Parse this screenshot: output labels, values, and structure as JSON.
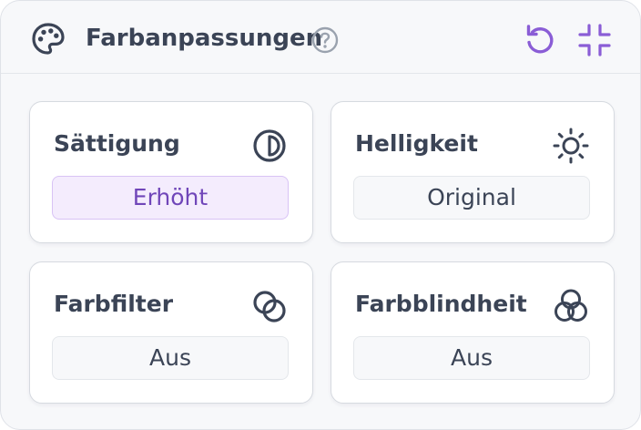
{
  "panel": {
    "title": "Farbanpassungen",
    "icons": {
      "header": "palette-icon",
      "help": "question-circle-icon",
      "reset": "reset-icon",
      "collapse": "collapse-icon"
    }
  },
  "cards": [
    {
      "label": "Sättigung",
      "value": "Erhöht",
      "icon": "contrast-icon",
      "active": true
    },
    {
      "label": "Helligkeit",
      "value": "Original",
      "icon": "sun-icon",
      "active": false
    },
    {
      "label": "Farbfilter",
      "value": "Aus",
      "icon": "overlapping-circles-icon",
      "active": false
    },
    {
      "label": "Farbblindheit",
      "value": "Aus",
      "icon": "three-circles-icon",
      "active": false
    }
  ],
  "colors": {
    "accent": "#8a5dd6",
    "active_bg": "#f4ecfd",
    "text": "#3b4456",
    "panel_bg": "#f7f8fa",
    "card_bg": "#ffffff"
  }
}
